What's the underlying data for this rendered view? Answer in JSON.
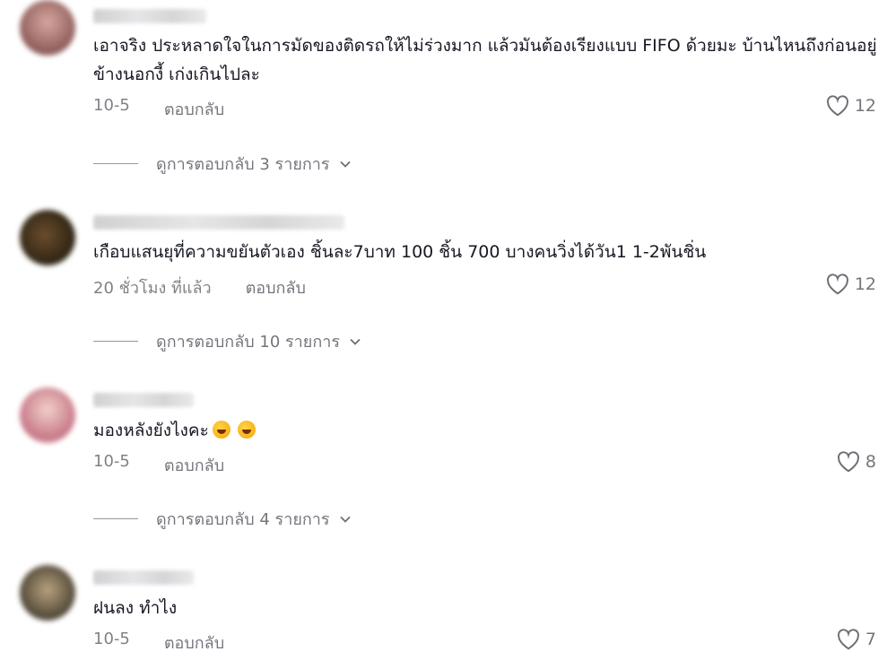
{
  "colors": {
    "text": "#161823",
    "muted": "#8a8b91"
  },
  "comments": [
    {
      "text": "เอาจริง ประหลาดใจในการมัดของติดรถให้ไม่ร่วงมาก แล้วมันต้องเรียงแบบ FIFO ด้วยมะ บ้านไหนถึงก่อนอยู่ข้างนอกงี้ เก่งเกินไปละ",
      "date": "10-5",
      "reply": "ตอบกลับ",
      "likes": "12",
      "view_replies": "ดูการตอบกลับ 3 รายการ"
    },
    {
      "text": "เกือบแสนยุที่ความขยันตัวเอง ชิ้นละ7บาท 100 ชิ้น 700 บางคนวิ่งได้วัน1 1-2พันชิ่น",
      "date": "20 ชั่วโมง ที่แล้ว",
      "reply": "ตอบกลับ",
      "likes": "12",
      "view_replies": "ดูการตอบกลับ 10 รายการ"
    },
    {
      "text": "มองหลังยังไงคะ",
      "emoji_icons": [
        "rolling-laughing-emoji",
        "rolling-laughing-emoji"
      ],
      "date": "10-5",
      "reply": "ตอบกลับ",
      "likes": "8",
      "view_replies": "ดูการตอบกลับ 4 รายการ"
    },
    {
      "text": "ฝนลง ทำไง",
      "date": "10-5",
      "reply": "ตอบกลับ",
      "likes": "7"
    }
  ]
}
